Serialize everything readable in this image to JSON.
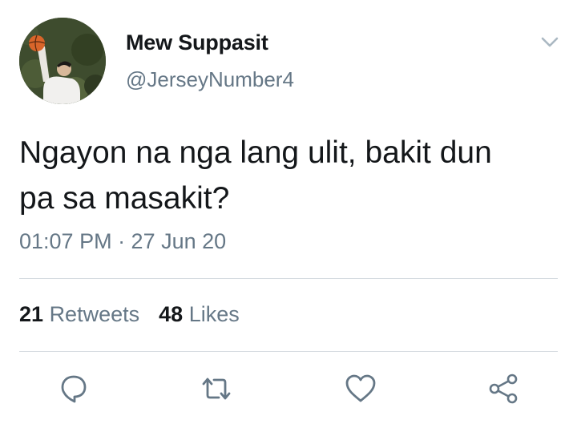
{
  "tweet": {
    "author": {
      "display_name": "Mew Suppasit",
      "handle": "@JerseyNumber4",
      "avatar_icon": "profile-photo-basketball"
    },
    "text_line1": "Ngayon na nga lang ulit, bakit dun",
    "text_line2": "pa sa masakit?",
    "timestamp": "01:07 PM · 27 Jun 20",
    "stats": {
      "retweets_count": "21",
      "retweets_label": "Retweets",
      "likes_count": "48",
      "likes_label": "Likes"
    },
    "actions": [
      {
        "icon": "reply-icon"
      },
      {
        "icon": "retweet-icon"
      },
      {
        "icon": "like-icon"
      },
      {
        "icon": "share-icon"
      }
    ],
    "more_icon": "chevron-down-icon"
  },
  "colors": {
    "text_primary": "#14171a",
    "text_secondary": "#657786",
    "icon_gray": "#657786",
    "divider": "#d5dbe0"
  }
}
